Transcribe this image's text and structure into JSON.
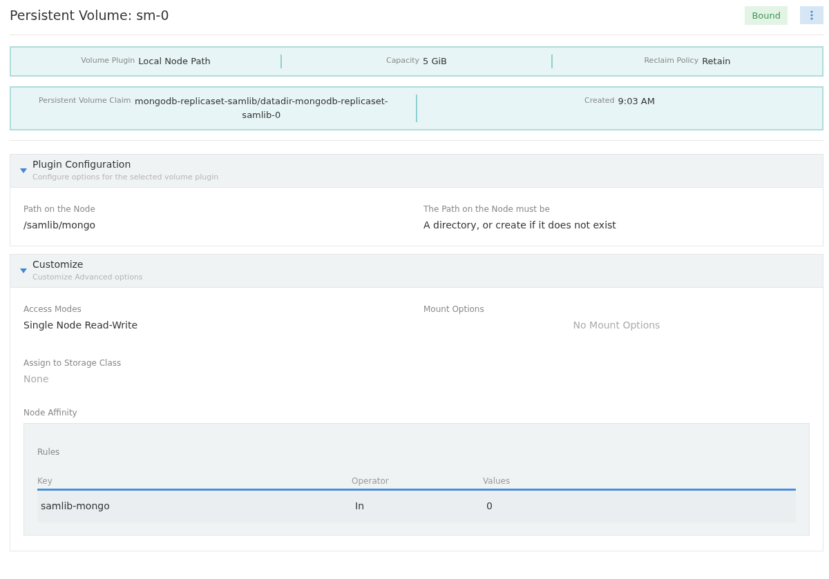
{
  "header": {
    "title": "Persistent Volume: sm-0",
    "status": "Bound"
  },
  "summary_rows": [
    {
      "items": [
        {
          "label": "Volume Plugin",
          "value": "Local Node Path"
        },
        {
          "label": "Capacity",
          "value": "5 GiB"
        },
        {
          "label": "Reclaim Policy",
          "value": "Retain"
        }
      ]
    },
    {
      "items": [
        {
          "label": "Persistent Volume Claim",
          "value": "mongodb-replicaset-samlib/datadir-mongodb-replicaset-samlib-0"
        },
        {
          "label": "Created",
          "value": "9:03 AM"
        }
      ]
    }
  ],
  "plugin_configuration": {
    "title": "Plugin Configuration",
    "subtitle": "Configure options for the selected volume plugin",
    "expanded": true,
    "fields": [
      {
        "label": "Path on the Node",
        "value": "/samlib/mongo"
      },
      {
        "label": "The Path on the Node must be",
        "value": "A directory, or create if it does not exist"
      }
    ]
  },
  "customize": {
    "title": "Customize",
    "subtitle": "Customize Advanced options",
    "expanded": true,
    "access_modes": {
      "label": "Access Modes",
      "value": "Single Node Read-Write"
    },
    "mount_options": {
      "label": "Mount Options",
      "empty": "No Mount Options"
    },
    "storage_class": {
      "label": "Assign to Storage Class",
      "value": "None"
    },
    "node_affinity": {
      "label": "Node Affinity",
      "rules_label": "Rules",
      "columns": [
        "Key",
        "Operator",
        "Values"
      ],
      "rows": [
        [
          "samlib-mongo",
          "In",
          "0"
        ]
      ]
    }
  }
}
